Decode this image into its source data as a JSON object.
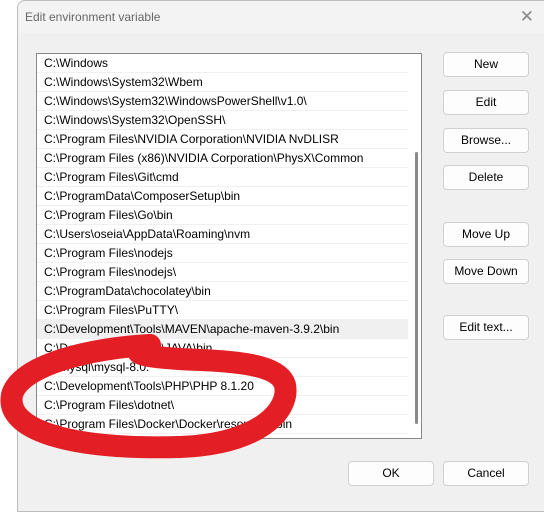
{
  "dialog": {
    "title": "Edit environment variable",
    "close_icon": "close-icon"
  },
  "paths": [
    "C:\\Windows",
    "C:\\Windows\\System32\\Wbem",
    "C:\\Windows\\System32\\WindowsPowerShell\\v1.0\\",
    "C:\\Windows\\System32\\OpenSSH\\",
    "C:\\Program Files\\NVIDIA Corporation\\NVIDIA NvDLISR",
    "C:\\Program Files (x86)\\NVIDIA Corporation\\PhysX\\Common",
    "C:\\Program Files\\Git\\cmd",
    "C:\\ProgramData\\ComposerSetup\\bin",
    "C:\\Program Files\\Go\\bin",
    "C:\\Users\\oseia\\AppData\\Roaming\\nvm",
    "C:\\Program Files\\nodejs",
    "C:\\Program Files\\nodejs\\",
    "C:\\ProgramData\\chocolatey\\bin",
    "C:\\Program Files\\PuTTY\\",
    "C:\\Development\\Tools\\MAVEN\\apache-maven-3.9.2\\bin",
    "C:\\Development\\Tools\\JAVA\\bin",
    "C:\\mysql\\mysql-8.0.",
    "C:\\Development\\Tools\\PHP\\PHP 8.1.20",
    "C:\\Program Files\\dotnet\\",
    "C:\\Program Files\\Docker\\Docker\\resources\\bin"
  ],
  "selected_index": 14,
  "buttons": {
    "new": "New",
    "edit": "Edit",
    "browse": "Browse...",
    "delete": "Delete",
    "move_up": "Move Up",
    "move_down": "Move Down",
    "edit_text": "Edit text...",
    "ok": "OK",
    "cancel": "Cancel"
  },
  "annotation_color": "#e31e24"
}
